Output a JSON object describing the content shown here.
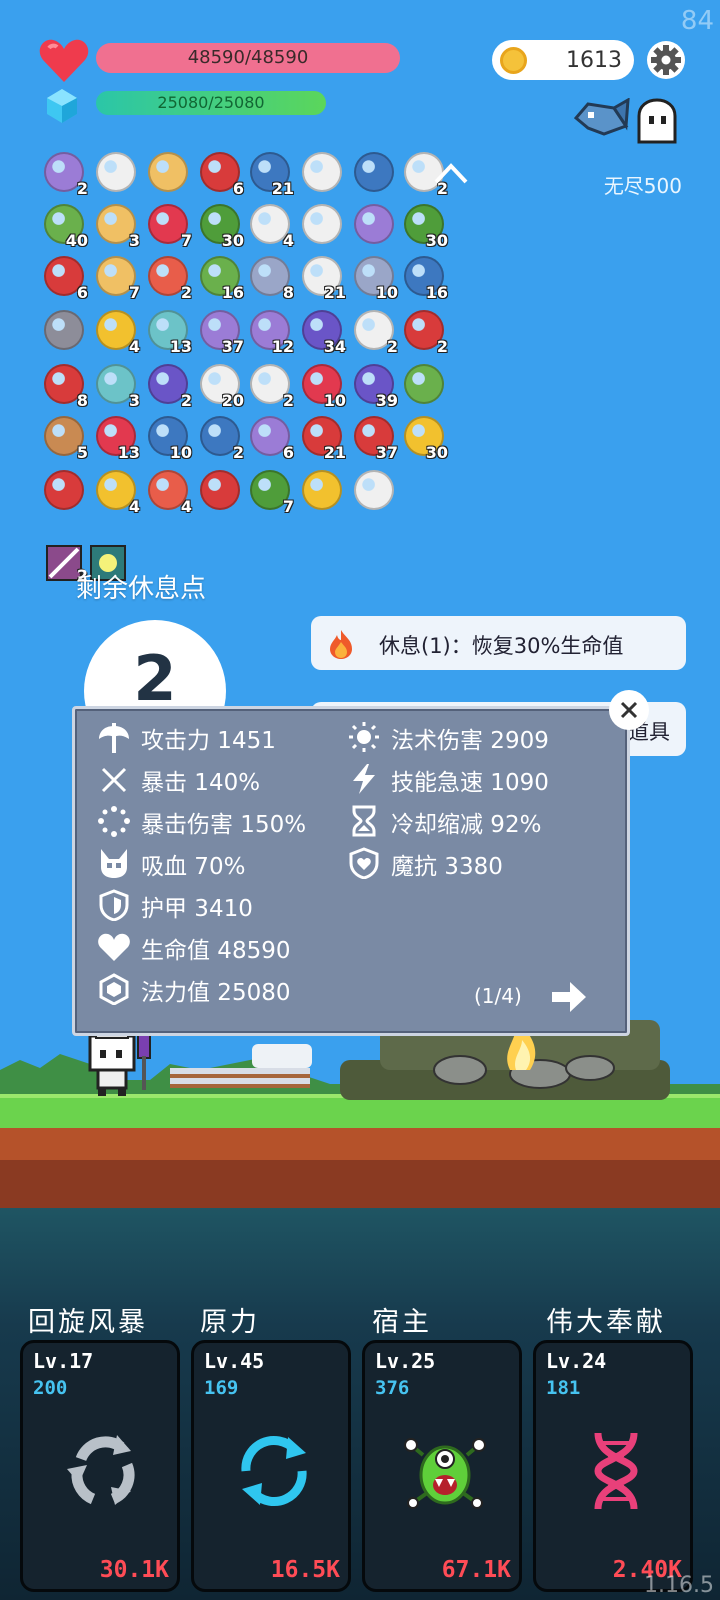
{
  "fps": "84",
  "version": "1.16.5",
  "hp": {
    "text": "48590/48590",
    "fill": 1.0,
    "color": "#f07090"
  },
  "mp": {
    "text": "25080/25080",
    "fill": 1.0
  },
  "coins": "1613",
  "mode_label": "无尽500",
  "items": [
    [
      {
        "icon": "round-shield-icon",
        "count": "2"
      },
      {
        "icon": "ruby-gem-icon",
        "count": ""
      },
      {
        "icon": "wizard-hat-icon",
        "count": ""
      },
      {
        "icon": "red-sock-icon",
        "count": "6"
      },
      {
        "icon": "gold-crown-icon",
        "count": "21"
      },
      {
        "icon": "torch-icon",
        "count": ""
      },
      {
        "icon": "magnet-icon",
        "count": ""
      },
      {
        "icon": "target-ring-icon",
        "count": "2"
      }
    ],
    [
      {
        "icon": "green-helmet-icon",
        "count": "40"
      },
      {
        "icon": "pill-icon",
        "count": "3"
      },
      {
        "icon": "cloud-icon",
        "count": "7"
      },
      {
        "icon": "spiked-ball-icon",
        "count": "30"
      },
      {
        "icon": "blue-shield-icon",
        "count": "4"
      },
      {
        "icon": "scroll-map-icon",
        "count": ""
      },
      {
        "icon": "unicorn-icon",
        "count": ""
      },
      {
        "icon": "grenade-icon",
        "count": "30"
      }
    ],
    [
      {
        "icon": "noose-icon",
        "count": "6"
      },
      {
        "icon": "battle-axe-icon",
        "count": "7"
      },
      {
        "icon": "bandaged-heart-icon",
        "count": "2"
      },
      {
        "icon": "dice-icon",
        "count": "16"
      },
      {
        "icon": "gold-ring-icon",
        "count": "8"
      },
      {
        "icon": "halo-icon",
        "count": "21"
      },
      {
        "icon": "capsule-icon",
        "count": "10"
      },
      {
        "icon": "sun-bulb-icon",
        "count": "16"
      }
    ],
    [
      {
        "icon": "wing-icon",
        "count": ""
      },
      {
        "icon": "cauldron-icon",
        "count": "4"
      },
      {
        "icon": "ghost-icon",
        "count": "13"
      },
      {
        "icon": "mushroom-icon",
        "count": "37"
      },
      {
        "icon": "slime-icon",
        "count": "12"
      },
      {
        "icon": "playing-cards-icon",
        "count": "34"
      },
      {
        "icon": "watermelon-icon",
        "count": "2"
      },
      {
        "icon": "magic-wand-icon",
        "count": "2"
      }
    ],
    [
      {
        "icon": "coconut-drink-icon",
        "count": "8"
      },
      {
        "icon": "lightbulb-icon",
        "count": "3"
      },
      {
        "icon": "star-shield-icon",
        "count": "2"
      },
      {
        "icon": "cash-heart-icon",
        "count": "20"
      },
      {
        "icon": "meteor-icon",
        "count": "2"
      },
      {
        "icon": "coconut-icon",
        "count": "10"
      },
      {
        "icon": "fried-egg-icon",
        "count": "39"
      },
      {
        "icon": "sunflower-icon",
        "count": ""
      }
    ],
    [
      {
        "icon": "crystal-ball-icon",
        "count": "5"
      },
      {
        "icon": "bat-icon",
        "count": "13"
      },
      {
        "icon": "bow-icon",
        "count": "10"
      },
      {
        "icon": "purple-box-icon",
        "count": "2"
      },
      {
        "icon": "note-pencil-icon",
        "count": "6"
      },
      {
        "icon": "green-monster-icon",
        "count": "21"
      },
      {
        "icon": "ice-cream-icon",
        "count": "37"
      },
      {
        "icon": "compass-icon",
        "count": "30"
      }
    ],
    [
      {
        "icon": "envelope-icon",
        "count": ""
      },
      {
        "icon": "crosshair-icon",
        "count": "4"
      },
      {
        "icon": "hook-icon",
        "count": "4"
      },
      {
        "icon": "potion-bottle-icon",
        "count": ""
      },
      {
        "icon": "gift-box-icon",
        "count": "7"
      },
      {
        "icon": "sapphire-icon",
        "count": ""
      },
      {
        "icon": "coin-stack-icon",
        "count": ""
      }
    ]
  ],
  "special_items": [
    {
      "icon": "striped-tile-icon",
      "count": "2"
    },
    {
      "icon": "glowing-tile-icon",
      "count": ""
    }
  ],
  "rest": {
    "label": "剩余休息点",
    "count": "2",
    "rest_button": "休息(1)：恢复30%生命值",
    "item_button": "道具"
  },
  "stats_panel": {
    "left": [
      {
        "icon": "axe-icon",
        "text": "攻击力 1451"
      },
      {
        "icon": "crit-icon",
        "text": "暴击 140%"
      },
      {
        "icon": "crit-damage-icon",
        "text": "暴击伤害 150%"
      },
      {
        "icon": "vampire-icon",
        "text": "吸血 70%"
      },
      {
        "icon": "armor-icon",
        "text": "护甲 3410"
      },
      {
        "icon": "heart-icon",
        "text": "生命值 48590"
      },
      {
        "icon": "mana-icon",
        "text": "法力值 25080"
      }
    ],
    "right": [
      {
        "icon": "sun-icon",
        "text": "法术伤害 2909"
      },
      {
        "icon": "lightning-icon",
        "text": "技能急速 1090"
      },
      {
        "icon": "hourglass-icon",
        "text": "冷却缩减 92%"
      },
      {
        "icon": "magic-resist-icon",
        "text": "魔抗 3380"
      }
    ],
    "page": "(1/4)"
  },
  "skills": [
    {
      "name": "回旋风暴",
      "level": "Lv.17",
      "mana": "200",
      "damage": "30.1K",
      "icon": "whirlwind-icon",
      "color": "#b8c0c8"
    },
    {
      "name": "原力",
      "level": "Lv.45",
      "mana": "169",
      "damage": "16.5K",
      "icon": "force-cycle-icon",
      "color": "#2fc6ef"
    },
    {
      "name": "宿主",
      "level": "Lv.25",
      "mana": "376",
      "damage": "67.1K",
      "icon": "host-monster-icon",
      "color": "#5fcf3a"
    },
    {
      "name": "伟大奉献",
      "level": "Lv.24",
      "mana": "181",
      "damage": "2.40K",
      "icon": "dna-icon",
      "color": "#e8407a"
    }
  ]
}
